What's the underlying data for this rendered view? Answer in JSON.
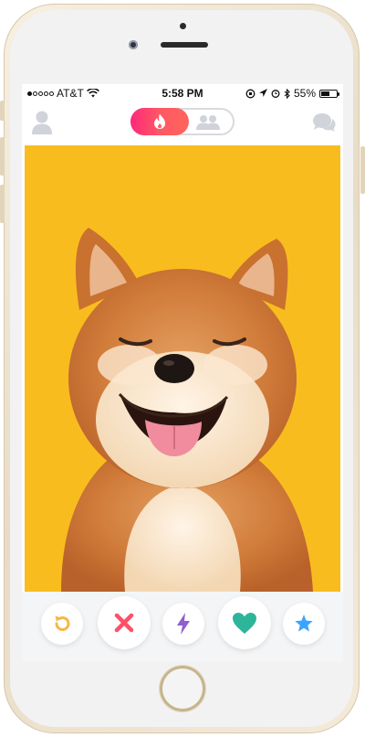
{
  "status_bar": {
    "carrier": "AT&T",
    "signal_bars_filled": 1,
    "signal_bars_total": 5,
    "time": "5:58 PM",
    "battery_percent": "55%",
    "battery_level": 0.55
  },
  "nav": {
    "profile_icon": "person-icon",
    "mode_active_icon": "flame-icon",
    "mode_inactive_icon": "group-icon",
    "chat_icon": "chat-bubbles-icon"
  },
  "card": {
    "photo_subject": "dog-photo",
    "background_color": "#f9bc1f"
  },
  "actions": [
    {
      "id": "rewind",
      "icon": "rewind-icon",
      "color": "#f5b748"
    },
    {
      "id": "nope",
      "icon": "x-icon",
      "color": "#fd5068"
    },
    {
      "id": "boost",
      "icon": "lightning-icon",
      "color": "#915dd1"
    },
    {
      "id": "like",
      "icon": "heart-icon",
      "color": "#2db59a"
    },
    {
      "id": "super-like",
      "icon": "star-icon",
      "color": "#3ca4ff"
    }
  ],
  "colors": {
    "brand_gradient_start": "#fd297b",
    "brand_gradient_end": "#ff655b",
    "inactive_icon": "#d0d3da"
  }
}
